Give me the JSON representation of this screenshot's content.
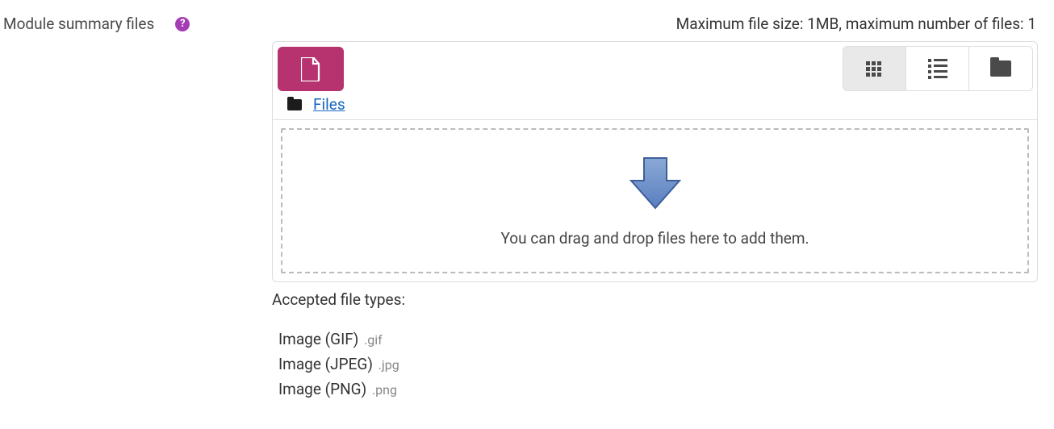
{
  "field": {
    "label": "Module summary files",
    "limits_text": "Maximum file size: 1MB, maximum number of files: 1"
  },
  "breadcrumb": {
    "link_text": "Files"
  },
  "dropzone": {
    "text": "You can drag and drop files here to add them."
  },
  "accepted": {
    "label": "Accepted file types:",
    "items": [
      {
        "name": "Image (GIF)",
        "ext": ".gif"
      },
      {
        "name": "Image (JPEG)",
        "ext": ".jpg"
      },
      {
        "name": "Image (PNG)",
        "ext": ".png"
      }
    ]
  }
}
